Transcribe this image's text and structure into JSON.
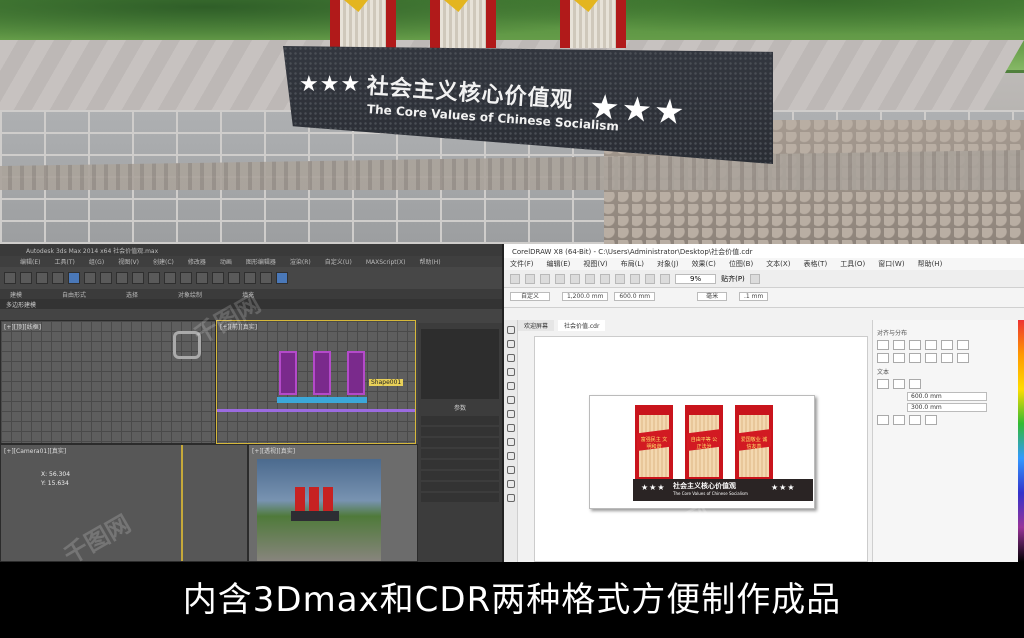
{
  "photo": {
    "monument_title": "社会主义核心价值观",
    "monument_subtitle": "The Core Values of Chinese Socialism",
    "stars_left": "★★★",
    "stars_right": "★★★"
  },
  "max_window": {
    "title": "Autodesk 3ds Max 2014 x64   社会价值观.max",
    "menu": [
      "编辑(E)",
      "工具(T)",
      "组(G)",
      "视图(V)",
      "创建(C)",
      "修改器",
      "动画",
      "图形编辑器",
      "渲染(R)",
      "自定义(U)",
      "MAXScript(X)",
      "帮助(H)"
    ],
    "ribbon_tabs": [
      "建模",
      "自由形式",
      "选择",
      "对象绘制",
      "填充"
    ],
    "panel_label": "多边形建模",
    "viewports": {
      "top_left": "[+][顶][线框]",
      "top_right": "[+][前][真实]",
      "bottom_left": "[+][Camera01][真实]",
      "bottom_right": "[+][透视][真实]"
    },
    "readout_x": "X: 56.304",
    "readout_y": "Y: 15.634",
    "selected_label": "Shape001",
    "panel_title": "参数"
  },
  "cdr_window": {
    "title": "CorelDRAW X8 (64-Bit) - C:\\Users\\Administrator\\Desktop\\社会价值.cdr",
    "menu": [
      "文件(F)",
      "编辑(E)",
      "视图(V)",
      "布局(L)",
      "对象(J)",
      "效果(C)",
      "位图(B)",
      "文本(X)",
      "表格(T)",
      "工具(O)",
      "窗口(W)",
      "帮助(H)"
    ],
    "zoom": "9%",
    "snap_label": "贴齐(P)",
    "preset": "自定义",
    "width": "1,200.0 mm",
    "height": "600.0 mm",
    "units": "毫米",
    "nudge": ".1 mm",
    "tabs": [
      "欢迎屏幕",
      "社会价值.cdr"
    ],
    "docker_title": "对齐与分布",
    "docker_text_label": "文本",
    "docker_field_1": "600.0 mm",
    "docker_field_2": "300.0 mm",
    "design_title": "社会主义核心价值观",
    "design_subtitle": "The Core Values of Chinese Socialism",
    "sign_texts": [
      "富强民主 文明和谐",
      "自由平等 公正法治",
      "爱国敬业 诚信友善"
    ]
  },
  "caption": "内含3Dmax和CDR两种格式方便制作成品"
}
